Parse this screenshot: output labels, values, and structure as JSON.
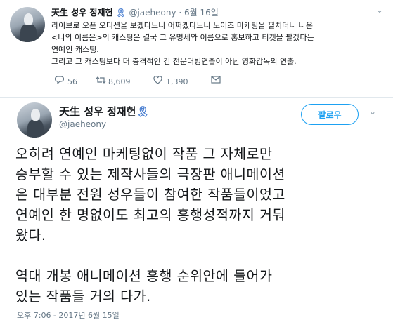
{
  "tweet1": {
    "display_name": "天生 성우 정재헌",
    "ribbon": "🎗",
    "handle": "@jaeheony",
    "separator": "·",
    "date": "6월 16일",
    "lines": [
      "라이브로 오픈 오디션을 보겠다느니 어쩌겠다느니 노이즈 마케팅을 펼치더니 나온",
      "<너의 이름은>의 캐스팅은 결국 그 유명세와 이름으로 홍보하고 티켓을 팔겠다는",
      "연예인 캐스팅.",
      "그리고 그 캐스팅보다 더 충격적인 건 전문더빙연출이 아닌 영화감독의 연출."
    ],
    "replies": "56",
    "retweets": "8,609",
    "likes": "1,390"
  },
  "tweet2": {
    "display_name": "天生 성우 정재헌",
    "ribbon": "🎗",
    "handle": "@jaeheony",
    "follow_label": "팔로우",
    "lines": [
      "오히려 연예인 마케팅없이 작품 그 자체로만",
      "승부할 수 있는 제작사들의 극장판 애니메이션",
      "은 대부분 전원 성우들이 참여한 작품들이었고",
      "연예인 한 명없이도 최고의 흥행성적까지 거둬",
      "왔다."
    ],
    "lines2": [
      "역대 개봉 애니메이션 흥행 순위안에 들어가",
      "있는 작품들 거의 다가."
    ],
    "timestamp": "오후 7:06 - 2017년 6월 15일"
  },
  "icons": {
    "reply": "💬",
    "retweet": "⇄",
    "like": "♡",
    "chevron": "⌄"
  },
  "colors": {
    "accent": "#1da1f2",
    "muted": "#657786",
    "ribbon": "#4a7fd1"
  }
}
